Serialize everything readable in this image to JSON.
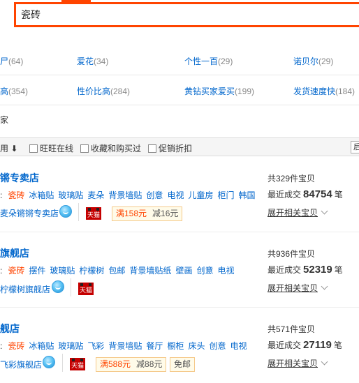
{
  "search": {
    "query": "瓷砖"
  },
  "attributes": {
    "row1": [
      {
        "label": "尸",
        "count": "(64)"
      },
      {
        "label": "爱花",
        "count": "(34)"
      },
      {
        "label": "个性一百",
        "count": "(29)"
      },
      {
        "label": "诺贝尔",
        "count": "(29)"
      }
    ],
    "row2": [
      {
        "label": "高",
        "count": "(354)"
      },
      {
        "label": "性价比高",
        "count": "(284)"
      },
      {
        "label": "黄钻买家爱买",
        "count": "(199)"
      },
      {
        "label": "发货速度快",
        "count": "(184)"
      }
    ],
    "row3_label": "家"
  },
  "filter_bar": {
    "sort_label": "用",
    "sort_arrow": "⬇",
    "checkboxes": [
      "旺旺在线",
      "收藏和购买过",
      "促销折扣"
    ],
    "right_control": "后"
  },
  "shops": [
    {
      "name": "锵专卖店",
      "keywords_highlight": "瓷砖",
      "keywords": [
        "冰箱贴",
        "玻璃贴",
        "麦朵",
        "背景墙贴",
        "创意",
        "电视",
        "儿童房",
        "柜门",
        "韩国"
      ],
      "owner": "麦朵锵锵专卖店",
      "tmall_label": "天猫",
      "promo_a": "满158元",
      "promo_b": "减16元",
      "total": "共329件宝贝",
      "recent_prefix": "最近成交",
      "recent_count": "84754",
      "recent_unit": "笔",
      "expand": "展开相关宝贝"
    },
    {
      "name": "旗舰店",
      "keywords_highlight": "瓷砖",
      "keywords": [
        "摆件",
        "玻璃贴",
        "柠檬树",
        "包邮",
        "背景墙贴纸",
        "壁画",
        "创意",
        "电视"
      ],
      "owner": "柠檬树旗舰店",
      "tmall_label": "天猫",
      "total": "共936件宝贝",
      "recent_prefix": "最近成交",
      "recent_count": "52319",
      "recent_unit": "笔",
      "expand": "展开相关宝贝"
    },
    {
      "name": "舰店",
      "keywords_highlight": "瓷砖",
      "keywords": [
        "冰箱贴",
        "玻璃贴",
        "飞彩",
        "背景墙贴",
        "餐厅",
        "橱柜",
        "床头",
        "创意",
        "电视"
      ],
      "owner": "飞彩旗舰店",
      "tmall_label": "天猫",
      "promo_a": "满588元",
      "promo_b": "减88元",
      "badge": "免邮",
      "total": "共571件宝贝",
      "recent_prefix": "最近成交",
      "recent_count": "27119",
      "recent_unit": "笔",
      "expand": "展开相关宝贝"
    }
  ]
}
